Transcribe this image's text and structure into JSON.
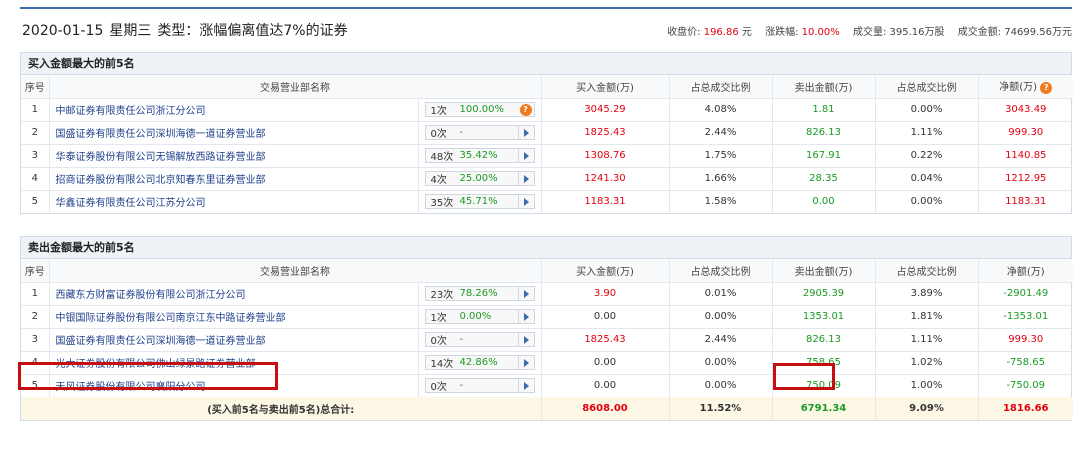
{
  "header": {
    "date": "2020-01-15",
    "weekday": "星期三",
    "type_label": "类型：涨幅偏离值达7%的证券",
    "close_label": "收盘价:",
    "close_value": "196.86",
    "close_unit": "元",
    "change_label": "涨跌幅:",
    "change_value": "10.00%",
    "volume_label": "成交量:",
    "volume_value": "395.16万股",
    "amount_label": "成交金额:",
    "amount_value": "74699.56万元"
  },
  "buy_section": {
    "title": "买入金额最大的前5名",
    "columns": [
      "序号",
      "交易营业部名称",
      "买入金额(万)",
      "占总成交比例",
      "卖出金额(万)",
      "占总成交比例",
      "净额(万)"
    ],
    "net_badge": "?",
    "rows": [
      {
        "idx": "1",
        "name": "中邮证券有限责任公司浙江分公司",
        "count": "1次",
        "pct": "100.00%",
        "buy": "3045.29",
        "buy_pct": "4.08%",
        "sell": "1.81",
        "sell_pct": "0.00%",
        "net": "3043.49",
        "flag": "?"
      },
      {
        "idx": "2",
        "name": "国盛证券有限责任公司深圳海德一道证券营业部",
        "count": "0次",
        "pct": "-",
        "buy": "1825.43",
        "buy_pct": "2.44%",
        "sell": "826.13",
        "sell_pct": "1.11%",
        "net": "999.30"
      },
      {
        "idx": "3",
        "name": "华泰证券股份有限公司无锡解放西路证券营业部",
        "count": "48次",
        "pct": "35.42%",
        "buy": "1308.76",
        "buy_pct": "1.75%",
        "sell": "167.91",
        "sell_pct": "0.22%",
        "net": "1140.85"
      },
      {
        "idx": "4",
        "name": "招商证券股份有限公司北京知春东里证券营业部",
        "count": "4次",
        "pct": "25.00%",
        "buy": "1241.30",
        "buy_pct": "1.66%",
        "sell": "28.35",
        "sell_pct": "0.04%",
        "net": "1212.95"
      },
      {
        "idx": "5",
        "name": "华鑫证券有限责任公司江苏分公司",
        "count": "35次",
        "pct": "45.71%",
        "buy": "1183.31",
        "buy_pct": "1.58%",
        "sell": "0.00",
        "sell_pct": "0.00%",
        "net": "1183.31"
      }
    ]
  },
  "sell_section": {
    "title": "卖出金额最大的前5名",
    "columns": [
      "序号",
      "交易营业部名称",
      "买入金额(万)",
      "占总成交比例",
      "卖出金额(万)",
      "占总成交比例",
      "净额(万)"
    ],
    "rows": [
      {
        "idx": "1",
        "name": "西藏东方财富证券股份有限公司浙江分公司",
        "count": "23次",
        "pct": "78.26%",
        "buy": "3.90",
        "buy_pct": "0.01%",
        "sell": "2905.39",
        "sell_pct": "3.89%",
        "net": "-2901.49"
      },
      {
        "idx": "2",
        "name": "中银国际证券股份有限公司南京江东中路证券营业部",
        "count": "1次",
        "pct": "0.00%",
        "buy": "0.00",
        "buy_pct": "0.00%",
        "sell": "1353.01",
        "sell_pct": "1.81%",
        "net": "-1353.01"
      },
      {
        "idx": "3",
        "name": "国盛证券有限责任公司深圳海德一道证券营业部",
        "count": "0次",
        "pct": "-",
        "buy": "1825.43",
        "buy_pct": "2.44%",
        "sell": "826.13",
        "sell_pct": "1.11%",
        "net": "999.30"
      },
      {
        "idx": "4",
        "name": "光大证券股份有限公司佛山绿景路证券营业部",
        "count": "14次",
        "pct": "42.86%",
        "buy": "0.00",
        "buy_pct": "0.00%",
        "sell": "758.65",
        "sell_pct": "1.02%",
        "net": "-758.65"
      },
      {
        "idx": "5",
        "name": "天风证券股份有限公司襄阳分公司",
        "count": "0次",
        "pct": "-",
        "buy": "0.00",
        "buy_pct": "0.00%",
        "sell": "750.09",
        "sell_pct": "1.00%",
        "net": "-750.09"
      }
    ],
    "total": {
      "label": "(买入前5名与卖出前5名)总合计:",
      "buy": "8608.00",
      "buy_pct": "11.52%",
      "sell": "6791.34",
      "sell_pct": "9.09%",
      "net": "1816.66"
    }
  }
}
